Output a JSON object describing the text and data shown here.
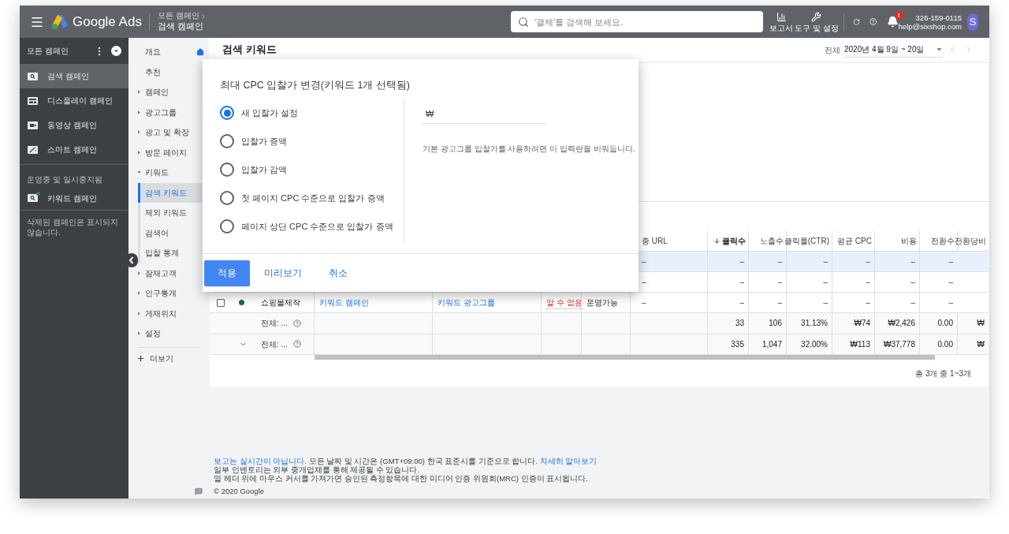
{
  "topbar": {
    "product": "Google Ads",
    "breadcrumb_parent": "모든 캠페인",
    "breadcrumb_current": "검색 캠페인",
    "search_placeholder": "'결제'를 검색해 보세요.",
    "tools": [
      {
        "kind": "reports",
        "label": "보고서"
      },
      {
        "kind": "tools",
        "label": "도구 및 설정"
      }
    ],
    "notification_badge": "!",
    "account_id": "326-159-0115",
    "account_email": "help@sixshop.com",
    "avatar": "S"
  },
  "sidebar": {
    "header": "모든 캠페인",
    "items": [
      {
        "kind": "search",
        "label": "검색 캠페인",
        "selected": true
      },
      {
        "kind": "display",
        "label": "디스플레이 캠페인",
        "selected": false
      },
      {
        "kind": "video",
        "label": "동영상 캠페인",
        "selected": false
      },
      {
        "kind": "smart",
        "label": "스마트 캠페인",
        "selected": false
      }
    ],
    "section_label": "운영중 및 일시중지됨",
    "campaigns": [
      {
        "label": "키워드 캠페인",
        "color": "#1e8e3e"
      }
    ],
    "note": "삭제된 캠페인은 표시되지 않습니다."
  },
  "nav": {
    "items": [
      {
        "kind": "home",
        "label": "개요"
      },
      {
        "kind": "plain",
        "label": "추천"
      },
      {
        "kind": "expandable",
        "label": "캠페인",
        "expanded": false
      },
      {
        "kind": "expandable",
        "label": "광고그룹",
        "expanded": false
      },
      {
        "kind": "expandable",
        "label": "광고 및 확장",
        "expanded": false
      },
      {
        "kind": "expandable",
        "label": "방문 페이지",
        "expanded": false
      },
      {
        "kind": "expandable",
        "label": "키워드",
        "expanded": true,
        "children": [
          {
            "label": "검색 키워드",
            "selected": true
          },
          {
            "label": "제외 키워드",
            "selected": false
          },
          {
            "label": "검색어",
            "selected": false
          },
          {
            "label": "입찰 통계",
            "selected": false
          }
        ]
      },
      {
        "kind": "expandable",
        "label": "잠재고객",
        "expanded": false
      },
      {
        "kind": "expandable",
        "label": "인구통계",
        "expanded": false
      },
      {
        "kind": "expandable",
        "label": "게재위치",
        "expanded": false
      },
      {
        "kind": "expandable",
        "label": "설정",
        "expanded": false
      }
    ],
    "more": "더보기"
  },
  "main": {
    "title": "검색 키워드",
    "date_label": "전체",
    "date_range": "2020년 4월 9일 ~ 20일"
  },
  "table": {
    "columns": [
      {
        "label": "종 URL",
        "sorted": false
      },
      {
        "label": "클릭수",
        "sorted": true
      },
      {
        "label": "노출수",
        "sorted": false
      },
      {
        "label": "클릭률(CTR)",
        "sorted": false
      },
      {
        "label": "평균 CPC",
        "sorted": false
      },
      {
        "label": "비용",
        "sorted": false
      },
      {
        "label": "전환수",
        "sorted": false
      },
      {
        "label": "전환당비",
        "sorted": false
      }
    ],
    "rows": [
      {
        "kind": "keyword",
        "selected": true,
        "final_url": "–",
        "metrics": [
          "–",
          "–",
          "–",
          "–",
          "–",
          "–"
        ]
      },
      {
        "kind": "keyword",
        "selected": false,
        "final_url": "–",
        "metrics": [
          "–",
          "–",
          "–",
          "–",
          "–",
          "–"
        ]
      },
      {
        "kind": "keyword",
        "selected": false,
        "checked": false,
        "color": "#137333",
        "keyword": "쇼핑몰제작",
        "campaign": "키워드 캠페인",
        "ad_group": "키워드 광고그룹",
        "status": "알 수 없음",
        "eligibility": "운영가능",
        "final_url": "–",
        "metrics": [
          "–",
          "–",
          "–",
          "–",
          "–",
          "–"
        ]
      },
      {
        "kind": "total",
        "collapsible": false,
        "label": "전체: ...",
        "metrics": [
          "33",
          "106",
          "31.13%",
          "₩74",
          "₩2,426",
          "0.00",
          "₩"
        ]
      },
      {
        "kind": "total",
        "collapsible": true,
        "label": "전체: ...",
        "metrics": [
          "335",
          "1,047",
          "32.00%",
          "₩113",
          "₩37,778",
          "0.00",
          "₩"
        ]
      }
    ],
    "pagination": "총 3개 중 1~3개"
  },
  "footer": {
    "lines": [
      [
        {
          "text": "보고는 실시간이 아닙니다.",
          "link": true
        },
        {
          "text": " 모든 날짜 및 시간은 (GMT+09:00) 한국 표준시를 기준으로 합니다. ",
          "link": false
        },
        {
          "text": "자세히 알아보기",
          "link": true
        }
      ],
      [
        {
          "text": "일부 인벤토리는 외부 중개업체를 통해 제공될 수 있습니다.",
          "link": false
        }
      ],
      [
        {
          "text": "열 헤더 위에 마우스 커서를 가져가면 승인된 측정항목에 대한 미디어 인증 위원회(MRC) 인증이 표시됩니다.",
          "link": false
        }
      ]
    ],
    "copyright": "© 2020 Google"
  },
  "dialog": {
    "title": "최대 CPC 입찰가 변경(키워드 1개 선택됨)",
    "options": [
      {
        "label": "새 입찰가 설정",
        "selected": true
      },
      {
        "label": "입찰가 증액",
        "selected": false
      },
      {
        "label": "입찰가 감액",
        "selected": false
      },
      {
        "label": "첫 페이지 CPC 수준으로 입찰가 증액",
        "selected": false
      },
      {
        "label": "페이지 상단 CPC 수준으로 입찰가 증액",
        "selected": false
      }
    ],
    "currency": "₩",
    "hint": "기본 광고그룹 입찰가를 사용하려면 이 입력란을 비워둡니다.",
    "buttons": [
      {
        "kind": "primary",
        "label": "적용"
      },
      {
        "kind": "text",
        "label": "미리보기"
      },
      {
        "kind": "text",
        "label": "취소"
      }
    ]
  }
}
